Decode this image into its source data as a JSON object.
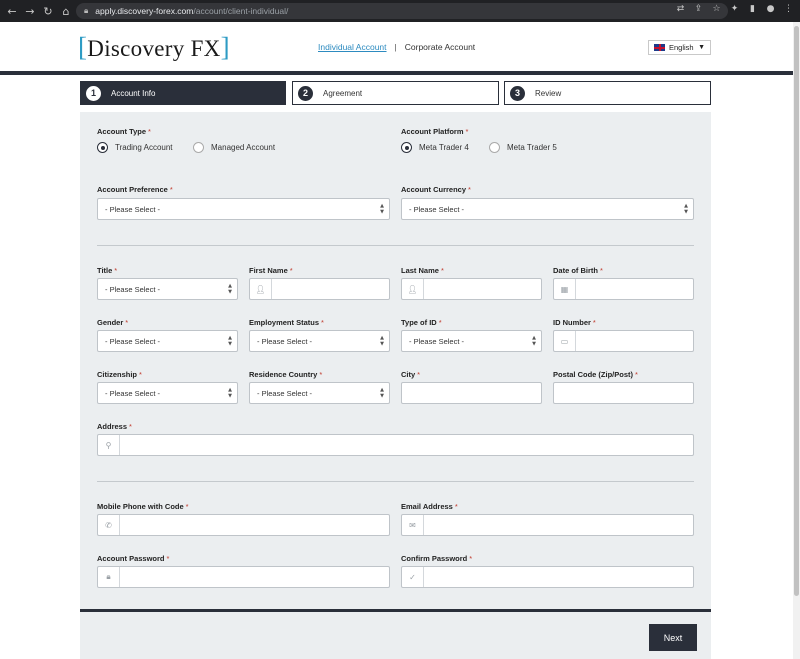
{
  "browser": {
    "url_host": "apply.discovery-forex.com",
    "url_path": "/account/client-individual/"
  },
  "header": {
    "logo_left": "[",
    "logo_text": "Discovery FX",
    "logo_right": "]",
    "link_individual": "Individual Account",
    "link_sep": "|",
    "link_corporate": "Corporate Account",
    "language": "English",
    "language_caret": "▼"
  },
  "steps": [
    {
      "num": "1",
      "label": "Account Info"
    },
    {
      "num": "2",
      "label": "Agreement"
    },
    {
      "num": "3",
      "label": "Review"
    }
  ],
  "form": {
    "account_type": {
      "label": "Account Type",
      "options": [
        "Trading Account",
        "Managed Account"
      ],
      "selected": "Trading Account"
    },
    "account_platform": {
      "label": "Account Platform",
      "options": [
        "Meta Trader 4",
        "Meta Trader 5"
      ],
      "selected": "Meta Trader 4"
    },
    "account_preference": {
      "label": "Account Preference",
      "value": "- Please Select -"
    },
    "account_currency": {
      "label": "Account Currency",
      "value": "- Please Select -"
    },
    "title": {
      "label": "Title",
      "value": "- Please Select -"
    },
    "first_name": {
      "label": "First Name",
      "value": ""
    },
    "last_name": {
      "label": "Last Name",
      "value": ""
    },
    "date_of_birth": {
      "label": "Date of Birth",
      "value": ""
    },
    "gender": {
      "label": "Gender",
      "value": "- Please Select -"
    },
    "employment_status": {
      "label": "Employment Status",
      "value": "- Please Select -"
    },
    "type_of_id": {
      "label": "Type of ID",
      "value": "- Please Select -"
    },
    "id_number": {
      "label": "ID Number",
      "value": ""
    },
    "citizenship": {
      "label": "Citizenship",
      "value": "- Please Select -"
    },
    "residence_country": {
      "label": "Residence Country",
      "value": "- Please Select -"
    },
    "city": {
      "label": "City",
      "value": ""
    },
    "postal_code": {
      "label": "Postal Code (Zip/Post)",
      "value": ""
    },
    "address": {
      "label": "Address",
      "value": ""
    },
    "mobile_phone": {
      "label": "Mobile Phone with Code",
      "value": ""
    },
    "email": {
      "label": "Email Address",
      "value": ""
    },
    "password": {
      "label": "Account Password",
      "value": ""
    },
    "confirm_password": {
      "label": "Confirm Password",
      "value": ""
    },
    "required_mark": "*"
  },
  "actions": {
    "next_label": "Next"
  }
}
